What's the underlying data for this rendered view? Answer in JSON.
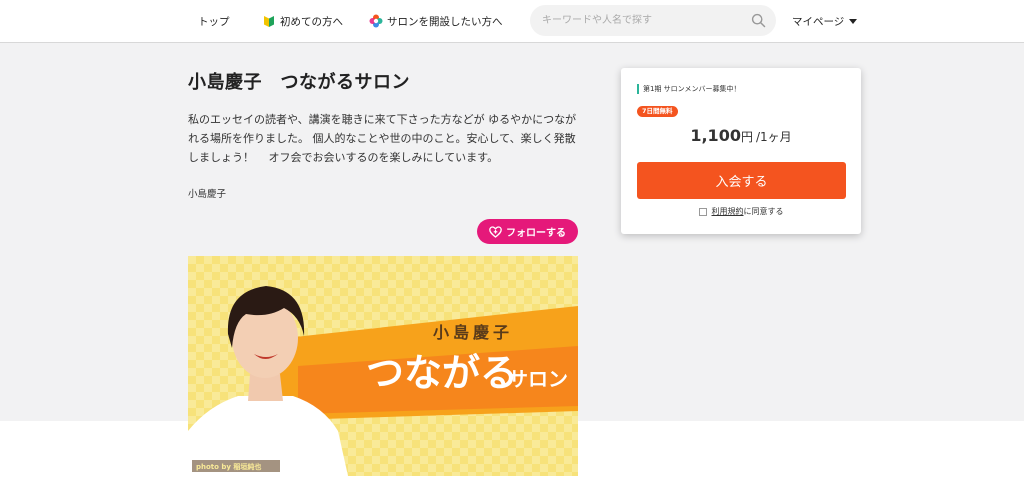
{
  "header": {
    "nav": [
      {
        "label": "トップ",
        "icon": "none"
      },
      {
        "label": "初めての方へ",
        "icon": "beginner-leaf-icon"
      },
      {
        "label": "サロンを開設したい方へ",
        "icon": "colorful-logo-icon"
      }
    ],
    "search": {
      "placeholder": "キーワードや人名で探す",
      "value": ""
    },
    "mypage_label": "マイページ"
  },
  "salon": {
    "title": "小島慶子　つながるサロン",
    "description": "私のエッセイの読者や、講演を聴きに来て下さった方などが ゆるやかにつながれる場所を作りました。 個人的なことや世の中のこと。安心して、楽しく発散しましょう！　 オフ会でお会いするのを楽しみにしています。",
    "owner": "小島慶子",
    "follow_label": "フォローする"
  },
  "banner": {
    "name_text": "小島慶子",
    "title_main": "つながる",
    "title_sub": "サロン",
    "credit": "photo by 稲垣純也"
  },
  "card": {
    "term_label": "第1期 サロンメンバー募集中！",
    "trial_badge": "7日間無料",
    "price_value": "1,100",
    "price_unit": "円",
    "price_period": "/1ヶ月",
    "join_label": "入会する",
    "terms_link": "利用規約",
    "agree_suffix": "に同意する"
  },
  "colors": {
    "accent_orange": "#f4541f",
    "follow_pink": "#e5197a",
    "term_bar_green": "#2bb59a"
  }
}
